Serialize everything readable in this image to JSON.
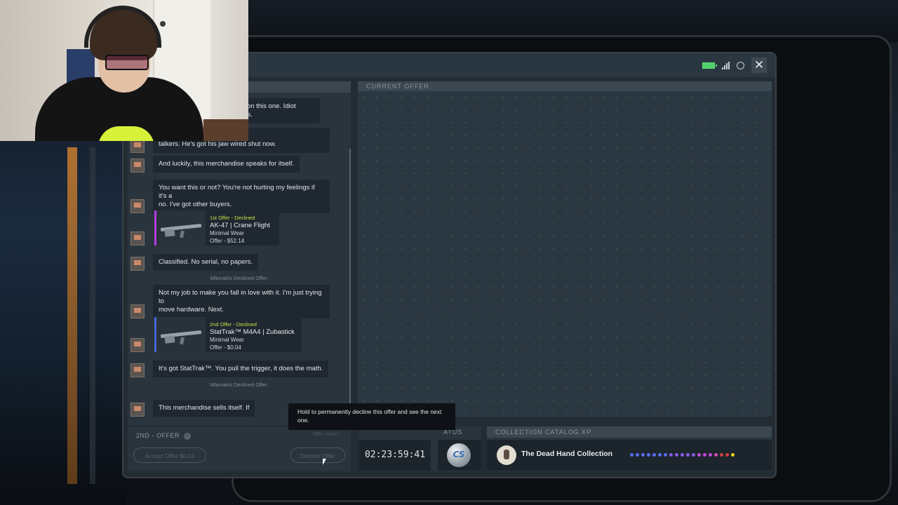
{
  "window": {
    "close_label": "✕",
    "icons": [
      "battery-icon",
      "signal-icon",
      "globe-icon",
      "close-icon"
    ]
  },
  "chat": {
    "messages": [
      {
        "text": "e on this one. Idiot\ners."
      },
      {
        "text": "w how to deal with the\ntalkers. He's got his jaw wired shut now."
      },
      {
        "text": "And luckily, this merchandise speaks for itself."
      },
      {
        "text": "You want this or not? You're not hurting my feelings if it's a\nno. I've got other buyers."
      },
      {
        "text": "Classified. No serial, no papers."
      },
      {
        "text": "Not my job to make you fall in love with it. I'm just trying to\nmove hardware. Next."
      },
      {
        "text": "It's got StatTrak™. You pull the trigger, it does the math."
      },
      {
        "text": "This merchandise sells itself. If"
      }
    ],
    "offers": [
      {
        "status": "1st Offer - Declined",
        "name": "AK-47 | Crane Flight",
        "wear": "Minimal Wear",
        "price": "Offer - $52.14",
        "rail_color": "#b43de0",
        "status_color": "#c8e04a"
      },
      {
        "status": "2nd Offer - Declined",
        "name": "StatTrak™ M4A4 | Zubastick",
        "wear": "Minimal Wear",
        "price": "Offer - $0.04",
        "rail_color": "#4a63d8",
        "status_color": "#c8e04a"
      }
    ],
    "system_messages": [
      "Mlionakis Declined Offer.",
      "Mlionakis Declined Offer."
    ]
  },
  "bottom": {
    "offer_label": "2ND - OFFER",
    "info_icon": "i",
    "right_note": "Offer never... ",
    "accept_label": "Accept Offer $0.04",
    "decline_label": "Decline Offer",
    "tooltip": "Hold to permanently decline this offer and see the next one."
  },
  "current_offer": {
    "header": "CURRENT OFFER"
  },
  "status": {
    "header": "ATUS",
    "timer": "02:23:59:41",
    "coin_text": "CS"
  },
  "xp": {
    "header": "COLLECTION CATALOG XP",
    "collection_name": "The Dead Hand Collection",
    "dot_colors": [
      "#5a6cf0",
      "#5a6cf0",
      "#5a6cf0",
      "#5a6cf0",
      "#5a6cf0",
      "#5a6cf0",
      "#5a6cf0",
      "#8a5ae8",
      "#8a5ae8",
      "#8a5ae8",
      "#8a5ae8",
      "#8a5ae8",
      "#c04ad8",
      "#c04ad8",
      "#c04ad8",
      "#d84ab0",
      "#d04040",
      "#d04040",
      "#e8d020"
    ]
  }
}
